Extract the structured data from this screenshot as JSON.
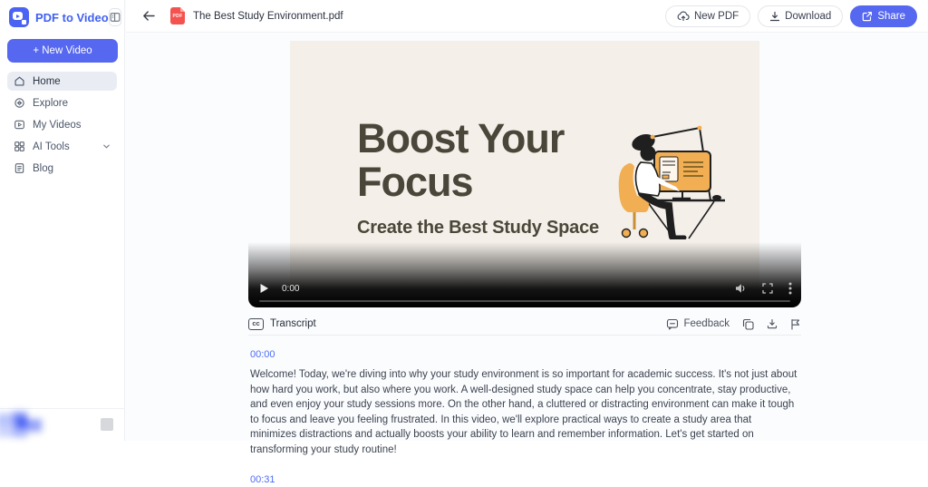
{
  "app": {
    "name": "PDF to Video"
  },
  "sidebar": {
    "new_video_label": "+ New Video",
    "items": [
      {
        "label": "Home"
      },
      {
        "label": "Explore"
      },
      {
        "label": "My Videos"
      },
      {
        "label": "AI Tools"
      },
      {
        "label": "Blog"
      }
    ]
  },
  "topbar": {
    "file_badge": "PDF",
    "filename": "The Best Study Environment.pdf",
    "new_pdf_label": "New PDF",
    "download_label": "Download",
    "share_label": "Share"
  },
  "player": {
    "current_time": "0:00",
    "slide": {
      "title": "Boost Your Focus",
      "subtitle": "Create the Best Study Space"
    }
  },
  "transcript": {
    "cc_label": "cc",
    "title": "Transcript",
    "feedback_label": "Feedback",
    "entries": [
      {
        "time": "00:00",
        "text": "Welcome! Today, we're diving into why your study environment is so important for academic success. It's not just about how hard you work, but also where you work. A well-designed study space can help you concentrate, stay productive, and even enjoy your study sessions more. On the other hand, a cluttered or distracting environment can make it tough to focus and leave you feeling frustrated. In this video, we'll explore practical ways to create a study area that minimizes distractions and actually boosts your ability to learn and remember information. Let's get started on transforming your study routine!"
      },
      {
        "time": "00:31",
        "text": ""
      }
    ]
  },
  "colors": {
    "accent_blue": "#5667f0",
    "logo_blue": "#4060f2",
    "timestamp_blue": "#4a6cf7",
    "pdf_red": "#f4524e",
    "slide_background": "#f4efe9",
    "slide_text": "#4a473a",
    "illustration_yellow": "#f1ae52"
  }
}
